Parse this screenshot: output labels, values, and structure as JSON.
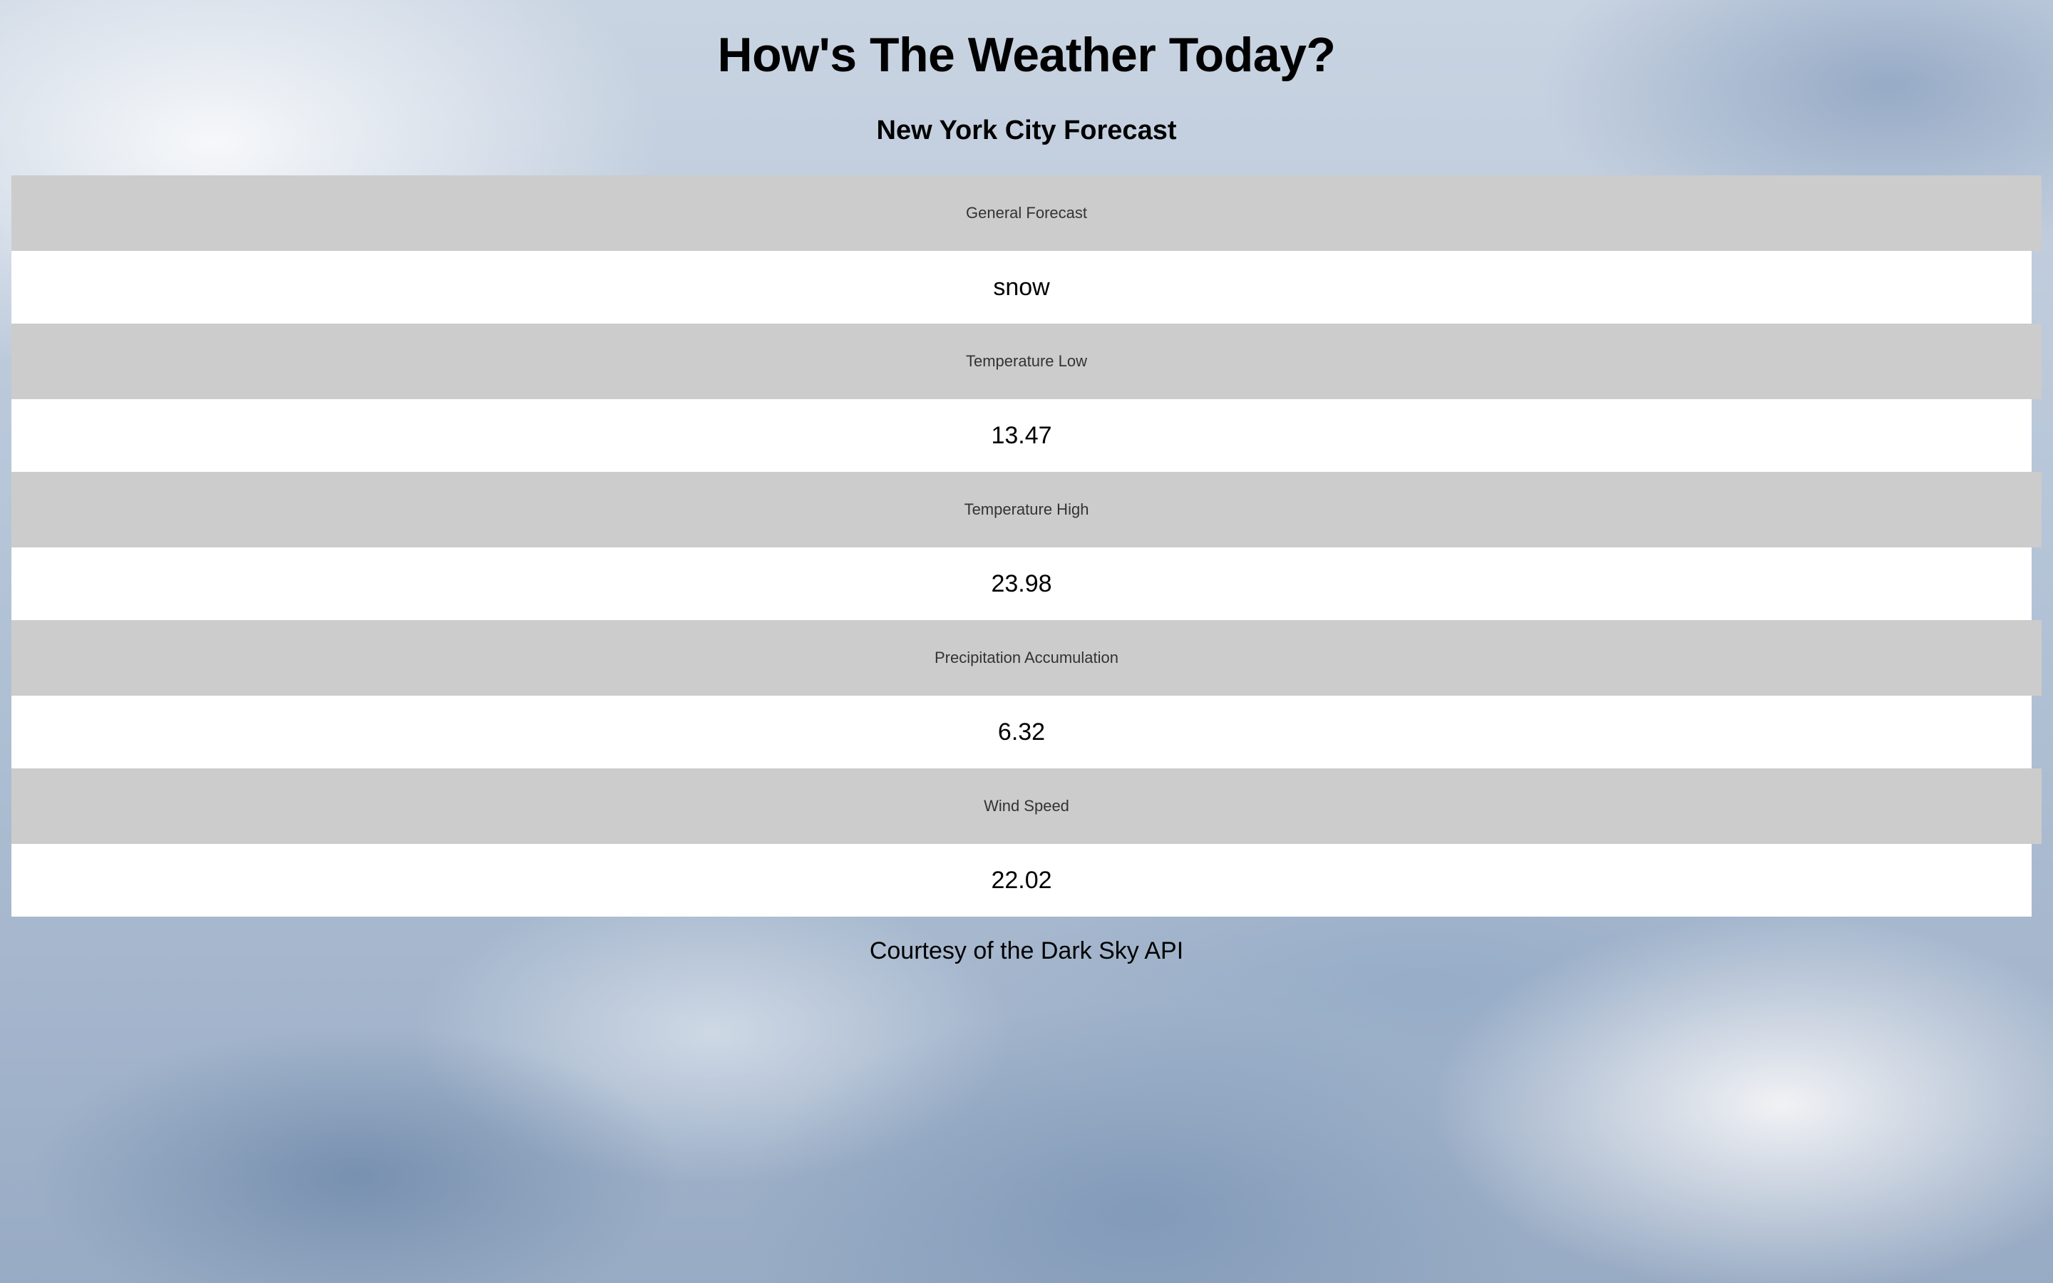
{
  "header": {
    "title": "How's The Weather Today?",
    "subtitle": "New York City Forecast"
  },
  "forecast": [
    {
      "label": "General Forecast",
      "value": "snow"
    },
    {
      "label": "Temperature Low",
      "value": "13.47"
    },
    {
      "label": "Temperature High",
      "value": "23.98"
    },
    {
      "label": "Precipitation Accumulation",
      "value": "6.32"
    },
    {
      "label": "Wind Speed",
      "value": "22.02"
    }
  ],
  "footer": {
    "credit": "Courtesy of the Dark Sky API"
  },
  "colors": {
    "label_bg": "#cccccc",
    "value_bg": "#ffffff",
    "label_text": "#333333"
  }
}
